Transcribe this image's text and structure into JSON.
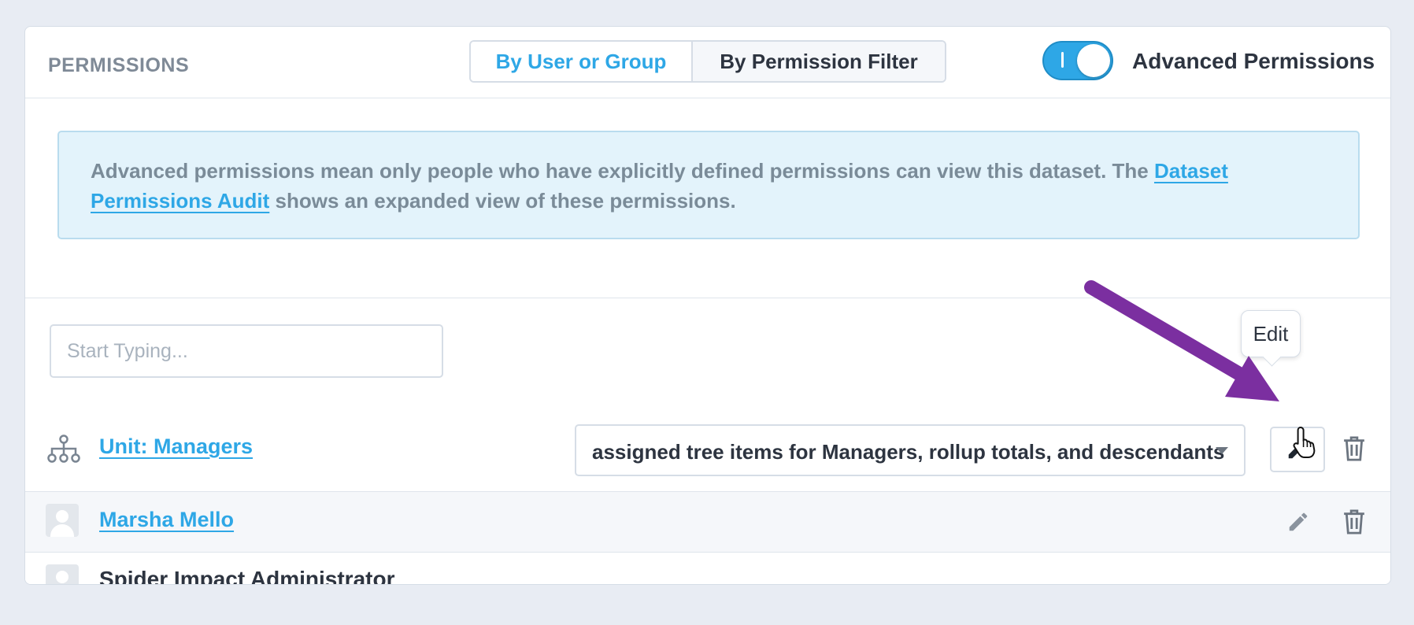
{
  "header": {
    "title": "PERMISSIONS",
    "view_tabs": [
      {
        "label": "By User or Group",
        "active": true
      },
      {
        "label": "By Permission Filter",
        "active": false
      }
    ],
    "advanced_toggle": {
      "label": "Advanced Permissions",
      "on": true
    }
  },
  "info": {
    "text_before": "Advanced permissions mean only people who have explicitly defined permissions can view this dataset. The ",
    "link": "Dataset Permissions Audit",
    "text_after": " shows an expanded view of these permissions."
  },
  "search": {
    "placeholder": "Start Typing..."
  },
  "rows": [
    {
      "name": "Unit: Managers",
      "icon": "org-tree-icon",
      "permission": "assigned tree items for Managers, rollup totals, and descendants"
    },
    {
      "name": "Marsha Mello",
      "icon": "user-avatar-icon"
    },
    {
      "name": "Spider Impact Administrator",
      "icon": "user-avatar-icon"
    }
  ],
  "tooltip": {
    "label": "Edit"
  },
  "colors": {
    "accent": "#2ea7e6",
    "annotation_arrow": "#7b2fa0",
    "info_bg": "#e3f3fb"
  }
}
